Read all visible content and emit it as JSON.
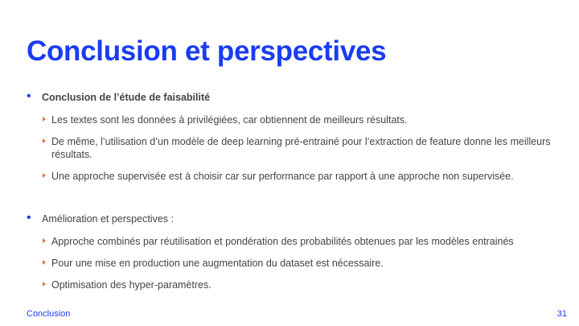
{
  "slide": {
    "title": "Conclusion et perspectives",
    "sections": [
      {
        "heading": "Conclusion de l’étude de faisabilité",
        "items": [
          "Les textes sont les données à privilégiées, car obtiennent de meilleurs résultats.",
          "De même, l’utilisation d’un modèle de deep learning pré-entrainé pour l’extraction de feature donne les meilleurs résultats.",
          "Une approche supervisée est à choisir car sur performance par rapport à une approche non supervisée."
        ]
      },
      {
        "heading": "Amélioration et perspectives :",
        "items": [
          "Approche combinés par réutilisation et pondération des probabilités obtenues par les modèles entrainés",
          "Pour une mise en production une augmentation du dataset est nécessaire.",
          "Optimisation des hyper-paramètres."
        ]
      }
    ],
    "footer": {
      "section": "Conclusion",
      "page_number": "31"
    }
  },
  "colors": {
    "accent": "#1a3cf0",
    "text": "#444444",
    "sub_bullet": "#e36f4a"
  }
}
